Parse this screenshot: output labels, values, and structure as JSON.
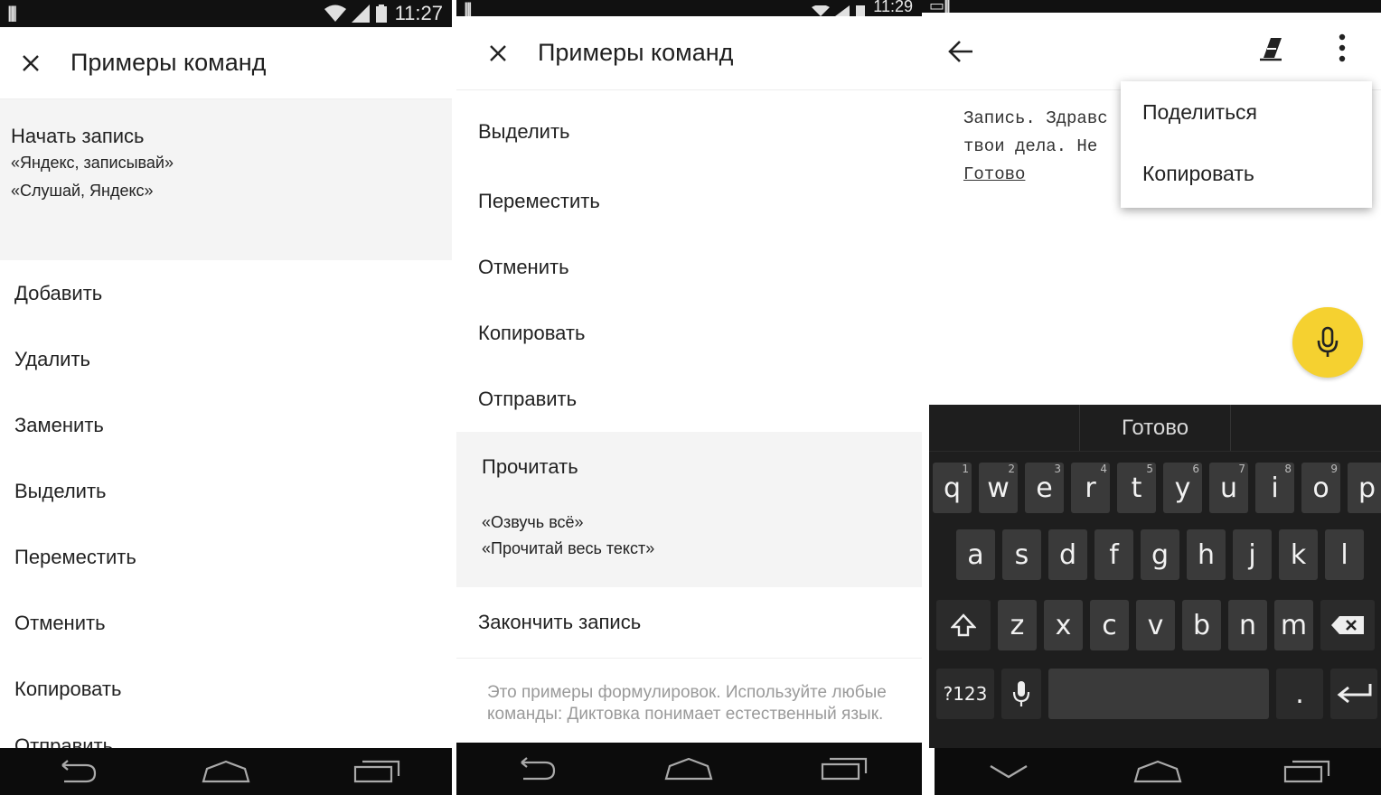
{
  "phone1": {
    "status": {
      "time": "11:27"
    },
    "appbar": {
      "title": "Примеры команд"
    },
    "expanded": {
      "title": "Начать запись",
      "examples": [
        "«Яндекс, записывай»",
        "«Слушай, Яндекс»"
      ]
    },
    "commands": [
      "Добавить",
      "Удалить",
      "Заменить",
      "Выделить",
      "Переместить",
      "Отменить",
      "Копировать",
      "Отправить"
    ]
  },
  "phone2": {
    "status": {
      "time": "11:29"
    },
    "appbar": {
      "title": "Примеры команд"
    },
    "commands_before": [
      "Выделить",
      "Переместить",
      "Отменить",
      "Копировать",
      "Отправить"
    ],
    "expanded": {
      "title": "Прочитать",
      "examples": [
        "«Озвучь всё»",
        "«Прочитай весь текст»"
      ]
    },
    "commands_after": [
      "Закончить запись"
    ],
    "footnote": "Это примеры формулировок. Используйте любые команды: Диктовка понимает естественный язык."
  },
  "phone3": {
    "document": {
      "line1": "Запись. Здравс",
      "line2": "твои дела. Не",
      "link": "Готово"
    },
    "menu": {
      "items": [
        "Поделиться",
        "Копировать"
      ]
    },
    "keyboard": {
      "suggestion": "Готово",
      "row1": [
        {
          "k": "q",
          "h": "1"
        },
        {
          "k": "w",
          "h": "2"
        },
        {
          "k": "e",
          "h": "3"
        },
        {
          "k": "r",
          "h": "4"
        },
        {
          "k": "t",
          "h": "5"
        },
        {
          "k": "y",
          "h": "6"
        },
        {
          "k": "u",
          "h": "7"
        },
        {
          "k": "i",
          "h": "8"
        },
        {
          "k": "o",
          "h": "9"
        },
        {
          "k": "p",
          "h": ""
        }
      ],
      "row2": [
        "a",
        "s",
        "d",
        "f",
        "g",
        "h",
        "j",
        "k",
        "l"
      ],
      "row3": [
        "z",
        "x",
        "c",
        "v",
        "b",
        "n",
        "m"
      ],
      "symbols_label": "?123",
      "period_label": "."
    },
    "colors": {
      "fab": "#f5d130",
      "keyboard_bg": "#1e1e1e",
      "key_bg": "#3a3a3a"
    }
  }
}
